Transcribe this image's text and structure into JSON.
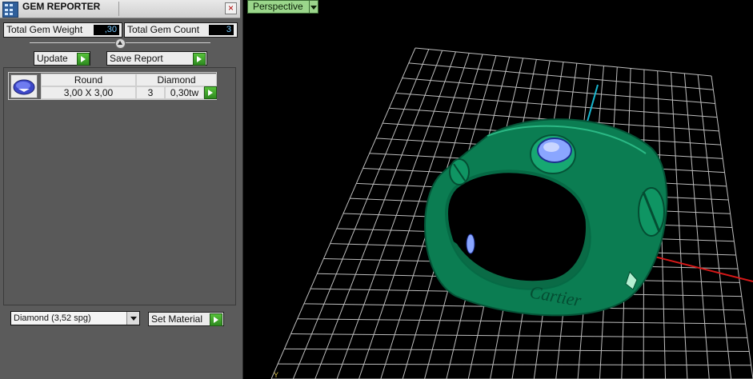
{
  "panel": {
    "title": "GEM REPORTER",
    "close_glyph": "×",
    "total_gem_weight_label": "Total Gem Weight",
    "total_gem_weight_value": ",30",
    "total_gem_count_label": "Total Gem Count",
    "total_gem_count_value": "3",
    "update_label": "Update",
    "save_report_label": "Save Report",
    "gem_table": {
      "shape": "Round",
      "material": "Diamond",
      "size": "3,00 X 3,00",
      "count": "3",
      "weight": "0,30tw"
    },
    "material_select_value": "Diamond     (3,52 spg)",
    "set_material_label": "Set Material"
  },
  "viewport": {
    "view_name": "Perspective",
    "axis_label": "Y"
  },
  "colors": {
    "ring_green": "#0e8a5a",
    "gem_blue": "#8aa6ff",
    "grid": "#bdbdbd",
    "axis_x": "#d81818",
    "axis_y": "#18b8d0",
    "viewport_label_bg": "#9bd68b"
  },
  "icons": [
    "gem-reporter-app-icon",
    "close-icon",
    "slider-knob-icon",
    "play-arrow-icon",
    "dropdown-arrow-icon",
    "gem-thumbnail-icon",
    "axis-gizmo-icon"
  ]
}
